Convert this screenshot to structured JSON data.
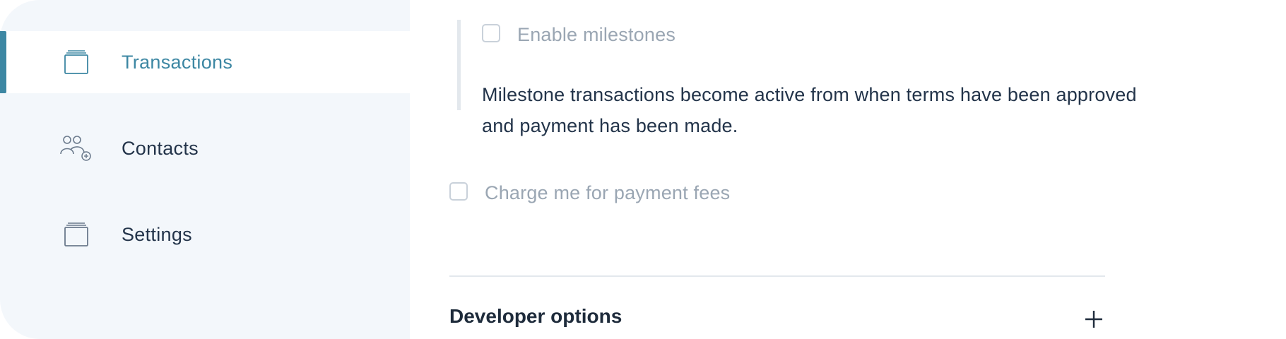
{
  "sidebar": {
    "items": [
      {
        "label": "Transactions",
        "icon": "transactions-icon",
        "active": true
      },
      {
        "label": "Contacts",
        "icon": "contacts-add-icon",
        "active": false
      },
      {
        "label": "Settings",
        "icon": "settings-icon",
        "active": false
      }
    ]
  },
  "main": {
    "milestones": {
      "checkbox_label": "Enable milestones",
      "checked": false,
      "description": "Milestone transactions become active from when terms have been approved and payment has been made."
    },
    "fees": {
      "checkbox_label": "Charge me for payment fees",
      "checked": false
    },
    "developer_options": {
      "title": "Developer options",
      "expand_icon": "plus-icon"
    }
  },
  "colors": {
    "accent": "#3d87a3",
    "sidebar_bg": "#f3f7fb",
    "text_primary": "#23344a",
    "text_muted": "#9aa6b3",
    "divider": "#e3e8ed"
  }
}
